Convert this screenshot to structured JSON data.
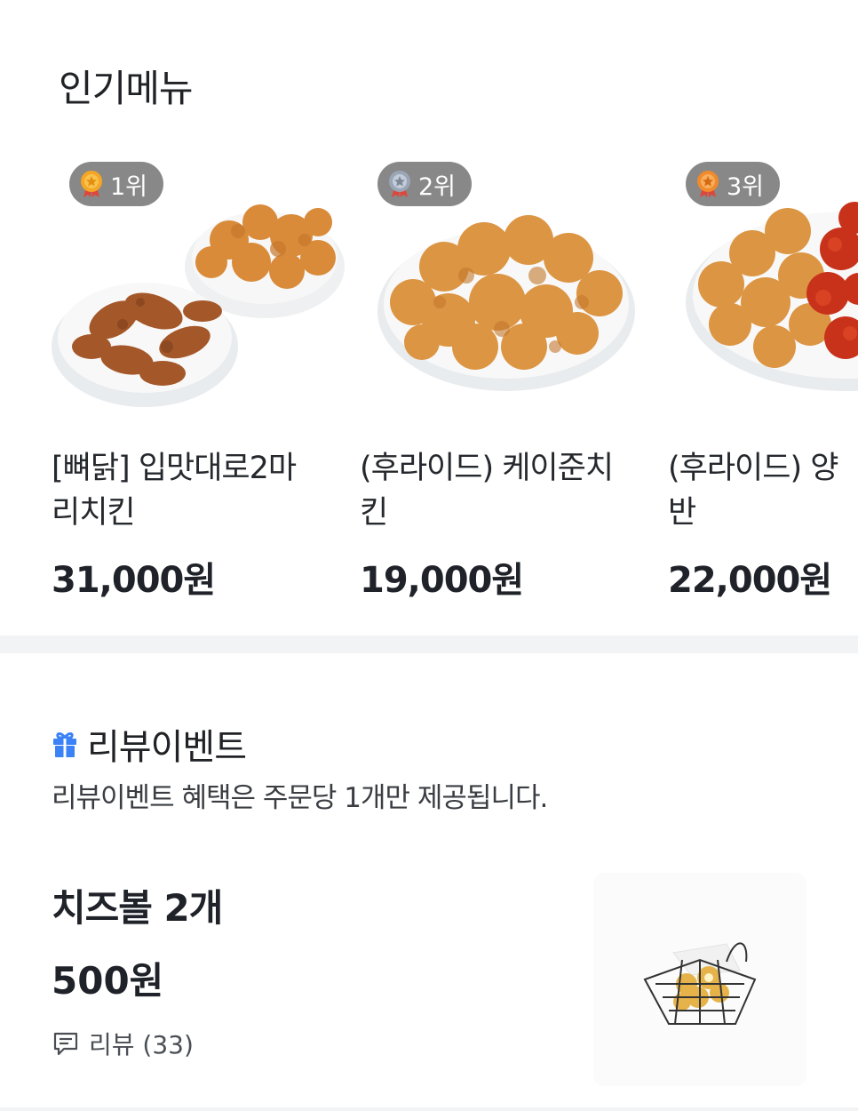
{
  "popular": {
    "title": "인기메뉴",
    "items": [
      {
        "rank": "1위",
        "medal": "gold-medal-icon",
        "name_line1": "[뼈닭] 입맛대로2마",
        "name_line2": "리치킨",
        "price": "31,000원"
      },
      {
        "rank": "2위",
        "medal": "silver-medal-icon",
        "name_line1": "(후라이드) 케이준치",
        "name_line2": "킨",
        "price": "19,000원"
      },
      {
        "rank": "3위",
        "medal": "bronze-medal-icon",
        "name_line1": "(후라이드) 양",
        "name_line2": "반",
        "price": "22,000원"
      }
    ]
  },
  "review_event": {
    "icon": "gift-icon",
    "title": "리뷰이벤트",
    "description": "리뷰이벤트 혜택은 주문당 1개만 제공됩니다.",
    "item": {
      "name": "치즈볼 2개",
      "price": "500원",
      "review_label": "리뷰 (33)"
    }
  },
  "colors": {
    "text": "#1f2329",
    "badge_bg": "#5a5a5a",
    "gift_blue": "#3b82f6",
    "divider": "#f2f3f5"
  }
}
